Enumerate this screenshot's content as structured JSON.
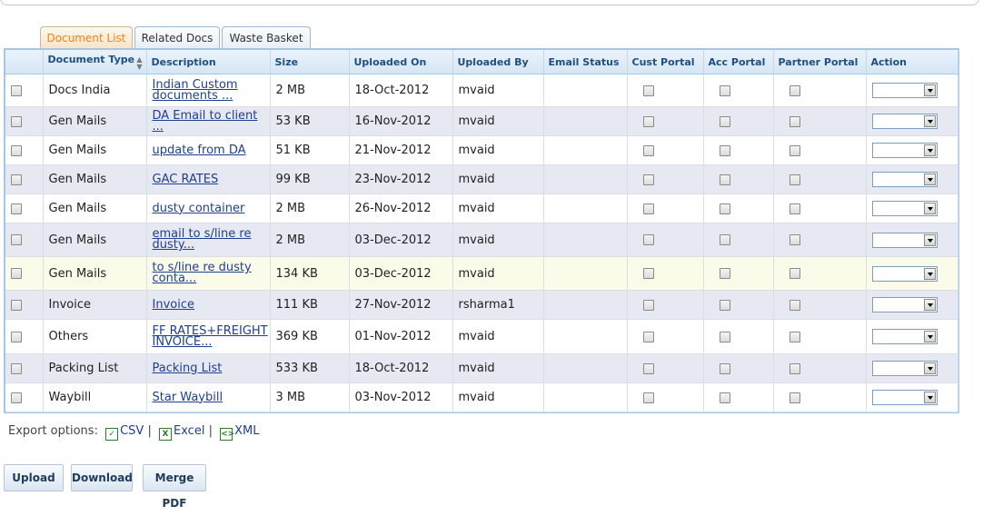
{
  "tabs": [
    {
      "label": "Document List"
    },
    {
      "label": "Related Docs"
    },
    {
      "label": "Waste Basket"
    }
  ],
  "columns": {
    "doc_type": "Document Type",
    "description": "Description",
    "size": "Size",
    "uploaded_on": "Uploaded On",
    "uploaded_by": "Uploaded By",
    "email_status": "Email Status",
    "cust_portal": "Cust Portal",
    "acc_portal": "Acc Portal",
    "partner_portal": "Partner Portal",
    "action": "Action"
  },
  "rows": [
    {
      "type": "Docs India",
      "desc": "Indian Custom documents ...",
      "size": "2 MB",
      "date": "18-Oct-2012",
      "by": "mvaid",
      "email": ""
    },
    {
      "type": "Gen Mails",
      "desc": "DA Email to client ...",
      "size": "53 KB",
      "date": "16-Nov-2012",
      "by": "mvaid",
      "email": ""
    },
    {
      "type": "Gen Mails",
      "desc": "update from DA",
      "size": "51 KB",
      "date": "21-Nov-2012",
      "by": "mvaid",
      "email": ""
    },
    {
      "type": "Gen Mails",
      "desc": "GAC RATES",
      "size": "99 KB",
      "date": "23-Nov-2012",
      "by": "mvaid",
      "email": ""
    },
    {
      "type": "Gen Mails",
      "desc": "dusty container",
      "size": "2 MB",
      "date": "26-Nov-2012",
      "by": "mvaid",
      "email": ""
    },
    {
      "type": "Gen Mails",
      "desc": "email to s/line re dusty...",
      "size": "2 MB",
      "date": "03-Dec-2012",
      "by": "mvaid",
      "email": ""
    },
    {
      "type": "Gen Mails",
      "desc": "to s/line re dusty conta...",
      "size": "134 KB",
      "date": "03-Dec-2012",
      "by": "mvaid",
      "email": ""
    },
    {
      "type": "Invoice",
      "desc": "Invoice",
      "size": "111 KB",
      "date": "27-Nov-2012",
      "by": "rsharma1",
      "email": ""
    },
    {
      "type": "Others",
      "desc": "FF RATES+FREIGHT INVOICE...",
      "size": "369 KB",
      "date": "01-Nov-2012",
      "by": "mvaid",
      "email": ""
    },
    {
      "type": "Packing List",
      "desc": "Packing List",
      "size": "533 KB",
      "date": "18-Oct-2012",
      "by": "mvaid",
      "email": ""
    },
    {
      "type": "Waybill",
      "desc": "Star Waybill",
      "size": "3 MB",
      "date": "03-Nov-2012",
      "by": "mvaid",
      "email": ""
    }
  ],
  "export": {
    "label": "Export options:",
    "csv": "CSV",
    "excel": "Excel",
    "xml": "XML",
    "sep": "|"
  },
  "buttons": {
    "upload": "Upload",
    "download": "Download",
    "merge_pdf": "Merge PDF"
  },
  "colors": {
    "accent_tab": "#f58220",
    "header_text": "#1f4f80",
    "link": "#1f3f8f",
    "grid_border": "#a7c6e2"
  }
}
